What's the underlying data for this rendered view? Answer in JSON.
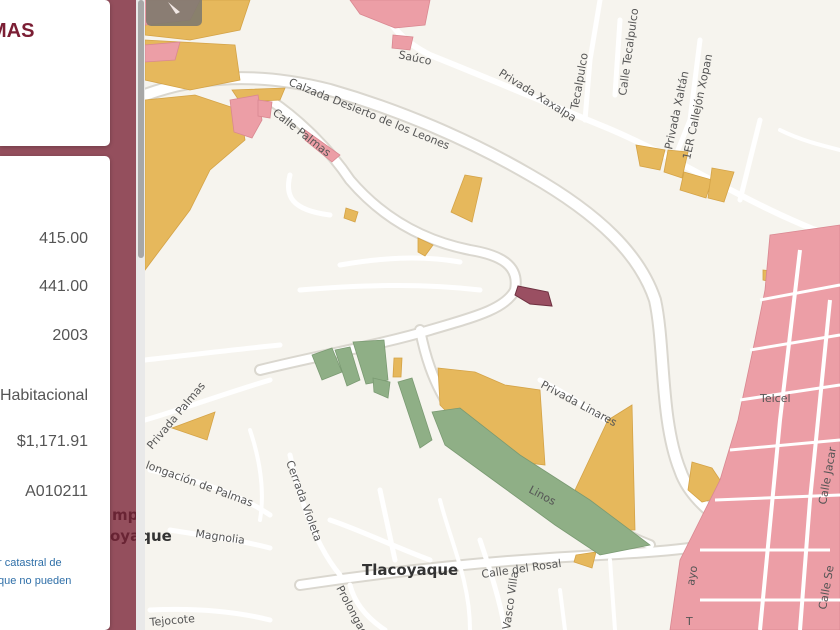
{
  "colors": {
    "background": "#f6f4ee",
    "road": "#ffffff",
    "road_casing": "#d9d6cf",
    "yellow": "#e6b85c",
    "pink": "#ec9ea6",
    "green": "#8faf86",
    "maroon": "#9a4f62",
    "sidebar": "#7b1e34"
  },
  "header": {
    "title_fragment": "MAS",
    "comma": ","
  },
  "info": {
    "values": [
      "415.00",
      "441.00",
      "2003",
      "Habitacional",
      "$1,171.91",
      "A010211"
    ],
    "note_lines": [
      "r catastral de",
      "que no pueden"
    ]
  },
  "map_labels": {
    "streets": [
      "Saúco",
      "Calzada Desierto de los Leones",
      "Calle Palmas",
      "Privada Xaxalpa",
      "Tecalpulco",
      "Calle Tecalpulco",
      "Privada Xaltán",
      "1ER Callejón Xopan",
      "Privada Linares",
      "Linos",
      "Calle del Rosal",
      "Cerrada Violeta",
      "longación de Palmas",
      "Magnolia",
      "Prolongac",
      "Privada Palmas",
      "Calle Jacar",
      "Calle Se",
      "Tejocote",
      "Telcel",
      "Vasco Villa",
      "ayo",
      "T"
    ],
    "places": [
      "Tlacoyaque",
      "oyaque",
      "mp"
    ]
  }
}
